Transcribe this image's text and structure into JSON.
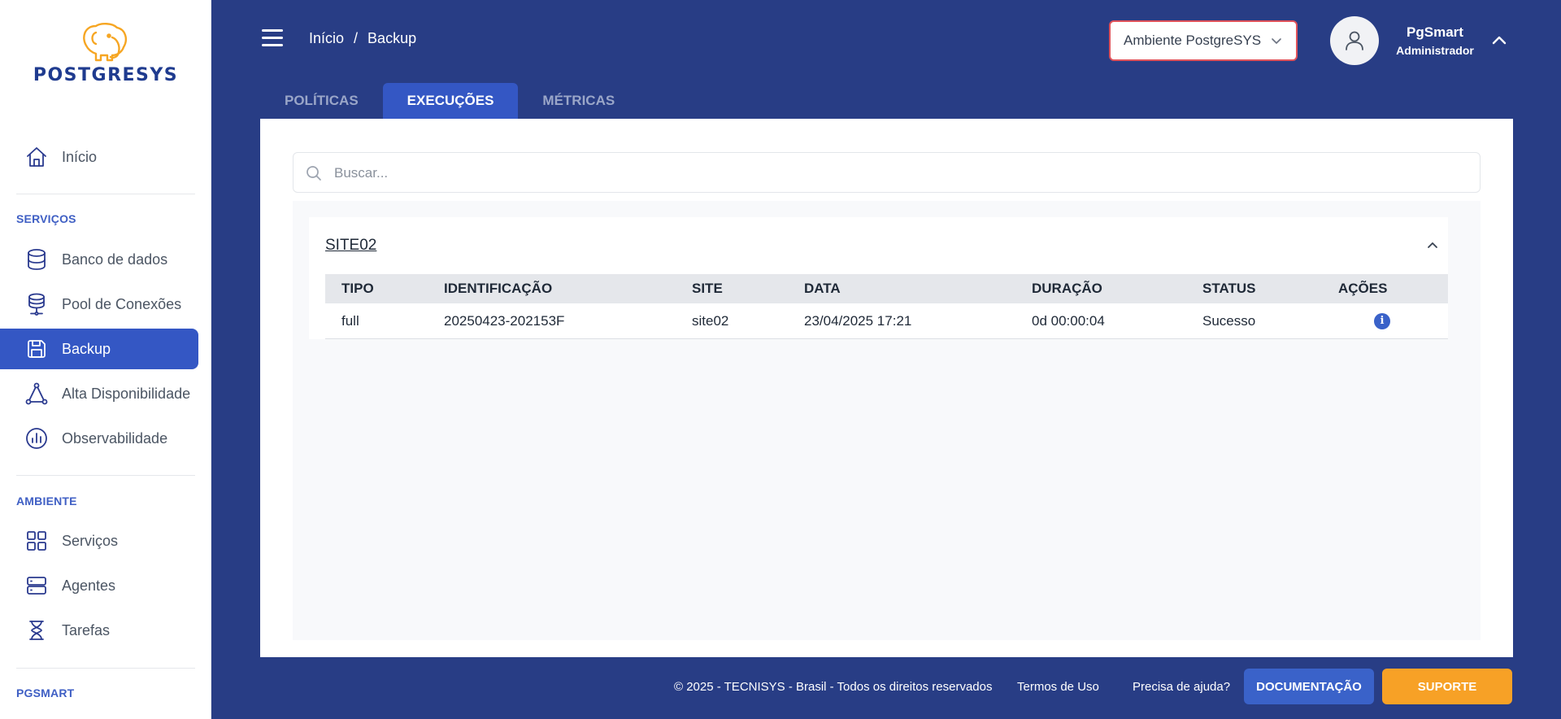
{
  "logo": {
    "text": "POSTGRESYS",
    "icon": "elephant-logo",
    "color": "#f6a623"
  },
  "sidebar": {
    "top_items": [
      {
        "label": "Início",
        "icon": "home-icon"
      }
    ],
    "sections": [
      {
        "title": "SERVIÇOS",
        "items": [
          {
            "label": "Banco de dados",
            "icon": "database-icon"
          },
          {
            "label": "Pool de Conexões",
            "icon": "connection-pool-icon"
          },
          {
            "label": "Backup",
            "icon": "save-icon",
            "active": true
          },
          {
            "label": "Alta Disponibilidade",
            "icon": "triangle-nodes-icon"
          },
          {
            "label": "Observabilidade",
            "icon": "bar-chart-circle-icon"
          }
        ]
      },
      {
        "title": "AMBIENTE",
        "items": [
          {
            "label": "Serviços",
            "icon": "grid-icon"
          },
          {
            "label": "Agentes",
            "icon": "server-icon"
          },
          {
            "label": "Tarefas",
            "icon": "hourglass-icon"
          }
        ]
      },
      {
        "title": "PGSMART",
        "items": []
      }
    ]
  },
  "header": {
    "breadcrumb": [
      "Início",
      "/",
      "Backup"
    ],
    "environment_select": "Ambiente PostgreSYS",
    "user_name": "PgSmart",
    "user_role": "Administrador"
  },
  "tabs": [
    {
      "label": "POLÍTICAS",
      "active": false
    },
    {
      "label": "EXECUÇÕES",
      "active": true
    },
    {
      "label": "MÉTRICAS",
      "active": false
    }
  ],
  "search": {
    "placeholder": "Buscar...",
    "value": ""
  },
  "groups": [
    {
      "title": "SITE02",
      "columns": [
        "TIPO",
        "IDENTIFICAÇÃO",
        "SITE",
        "DATA",
        "DURAÇÃO",
        "STATUS",
        "AÇÕES"
      ],
      "rows": [
        {
          "tipo": "full",
          "identificacao": "20250423-202153F",
          "site": "site02",
          "data": "23/04/2025 17:21",
          "duracao": "0d 00:00:04",
          "status": "Sucesso",
          "acao_icon": "info-icon"
        }
      ]
    }
  ],
  "footer": {
    "copyright": "© 2025 - TECNISYS - Brasil - Todos os direitos reservados",
    "terms": "Termos de Uso",
    "help": "Precisa de ajuda?",
    "doc_button": "DOCUMENTAÇÃO",
    "support_button": "SUPORTE"
  },
  "colors": {
    "primary_dark": "#283d85",
    "accent_blue": "#3457c4",
    "accent_orange": "#f7a126",
    "alert_border": "#e0525a"
  }
}
